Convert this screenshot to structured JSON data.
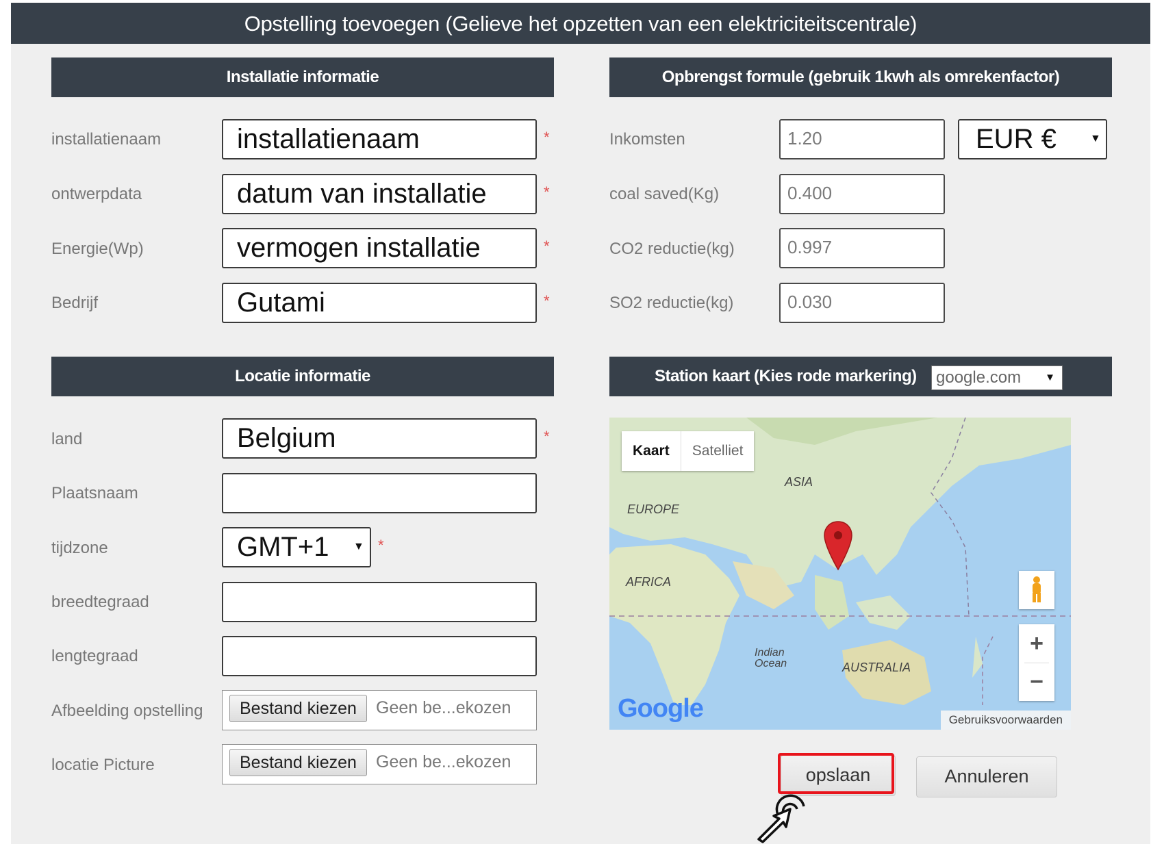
{
  "dialog": {
    "title": "Opstelling toevoegen (Gelieve het opzetten van een elektriciteitscentrale)"
  },
  "installation": {
    "header": "Installatie informatie",
    "fields": [
      {
        "label": "installatienaam",
        "value": "installatienaam",
        "required": "*"
      },
      {
        "label": "ontwerpdata",
        "value": "datum van installatie",
        "required": "*"
      },
      {
        "label": "Energie(Wp)",
        "value": "vermogen installatie",
        "required": "*"
      },
      {
        "label": "Bedrijf",
        "value": "Gutami",
        "required": "*"
      }
    ]
  },
  "yield": {
    "header": "Opbrengst formule (gebruik 1kwh als omrekenfactor)",
    "fields": [
      {
        "label": "Inkomsten",
        "value": "1.20"
      },
      {
        "label": "coal saved(Kg)",
        "value": "0.400"
      },
      {
        "label": "CO2 reductie(kg)",
        "value": "0.997"
      },
      {
        "label": "SO2 reductie(kg)",
        "value": "0.030"
      }
    ],
    "currency": "EUR €"
  },
  "location": {
    "header": "Locatie informatie",
    "country_label": "land",
    "country_value": "Belgium",
    "city_label": "Plaatsnaam",
    "city_value": "",
    "timezone_label": "tijdzone",
    "timezone_value": "GMT+1",
    "latitude_label": "breedtegraad",
    "latitude_value": "",
    "longitude_label": "lengtegraad",
    "longitude_value": "",
    "image_label": "Afbeelding opstelling",
    "picture_label": "locatie Picture",
    "file_button": "Bestand kiezen",
    "file_none": "Geen be...ekozen",
    "required": "*"
  },
  "map": {
    "header": "Station kaart (Kies rode markering)",
    "provider": "google.com",
    "tab_map": "Kaart",
    "tab_satellite": "Satelliet",
    "labels": {
      "asia": "ASIA",
      "europe": "EUROPE",
      "africa": "AFRICA",
      "indian_ocean_1": "Indian",
      "indian_ocean_2": "Ocean",
      "australia": "AUSTRALIA"
    },
    "logo": "Google",
    "terms": "Gebruiksvoorwaarden",
    "zoom_in": "+",
    "zoom_out": "−"
  },
  "actions": {
    "save": "opslaan",
    "cancel": "Annuleren"
  },
  "colors": {
    "header_bg": "#37404a",
    "dialog_bg": "#efefef",
    "required": "#e05050",
    "highlight": "#e8141c",
    "marker": "#d9262b"
  }
}
